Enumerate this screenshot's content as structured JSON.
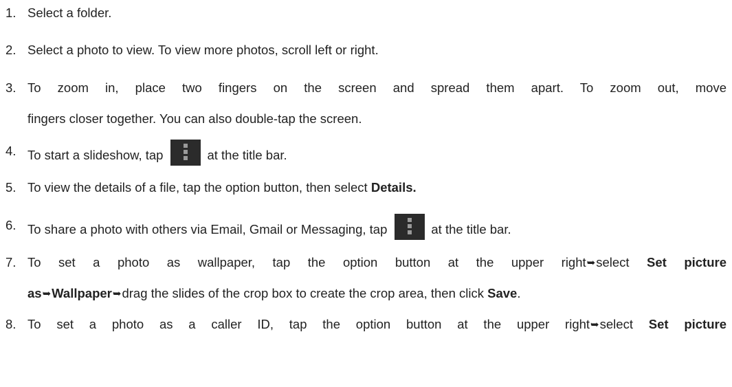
{
  "items": [
    {
      "number": "1.",
      "text": "Select a folder."
    },
    {
      "number": "2.",
      "text": "Select a photo to view. To view more photos, scroll left or right."
    },
    {
      "number": "3.",
      "line1": "To zoom in, place two fingers on the screen and spread them apart. To zoom out, move",
      "line2": "fingers closer together. You can also double-tap the screen."
    },
    {
      "number": "4.",
      "before_icon": "To start a slideshow, tap",
      "after_icon": "at the title bar.",
      "icon": "menu-overflow-icon"
    },
    {
      "number": "5.",
      "text": "To view the details of a file, tap the option button, then select",
      "bold": "Details."
    },
    {
      "number": "6.",
      "before_icon": "To share a photo with others via Email, Gmail or Messaging, tap",
      "after_icon": "at the title bar.",
      "icon": "menu-overflow-icon"
    },
    {
      "number": "7.",
      "l1_text": "To set a photo as wallpaper, tap the option button at the upper right",
      "l1_arrow": "➥",
      "l1_after": "select",
      "l1_bold": "Set picture",
      "l2_bold1": "as",
      "l2_arrow1": "➥",
      "l2_bold2": "Wallpaper",
      "l2_arrow2": "➥",
      "l2_text": "drag the slides of the crop box to create the crop area, then click",
      "l2_bold3": "Save",
      "l2_end": "."
    },
    {
      "number": "8.",
      "l1_text": "To set a photo as a caller ID, tap the option button at the upper right",
      "l1_arrow": "➥",
      "l1_after": "select",
      "l1_bold": "Set picture"
    }
  ]
}
